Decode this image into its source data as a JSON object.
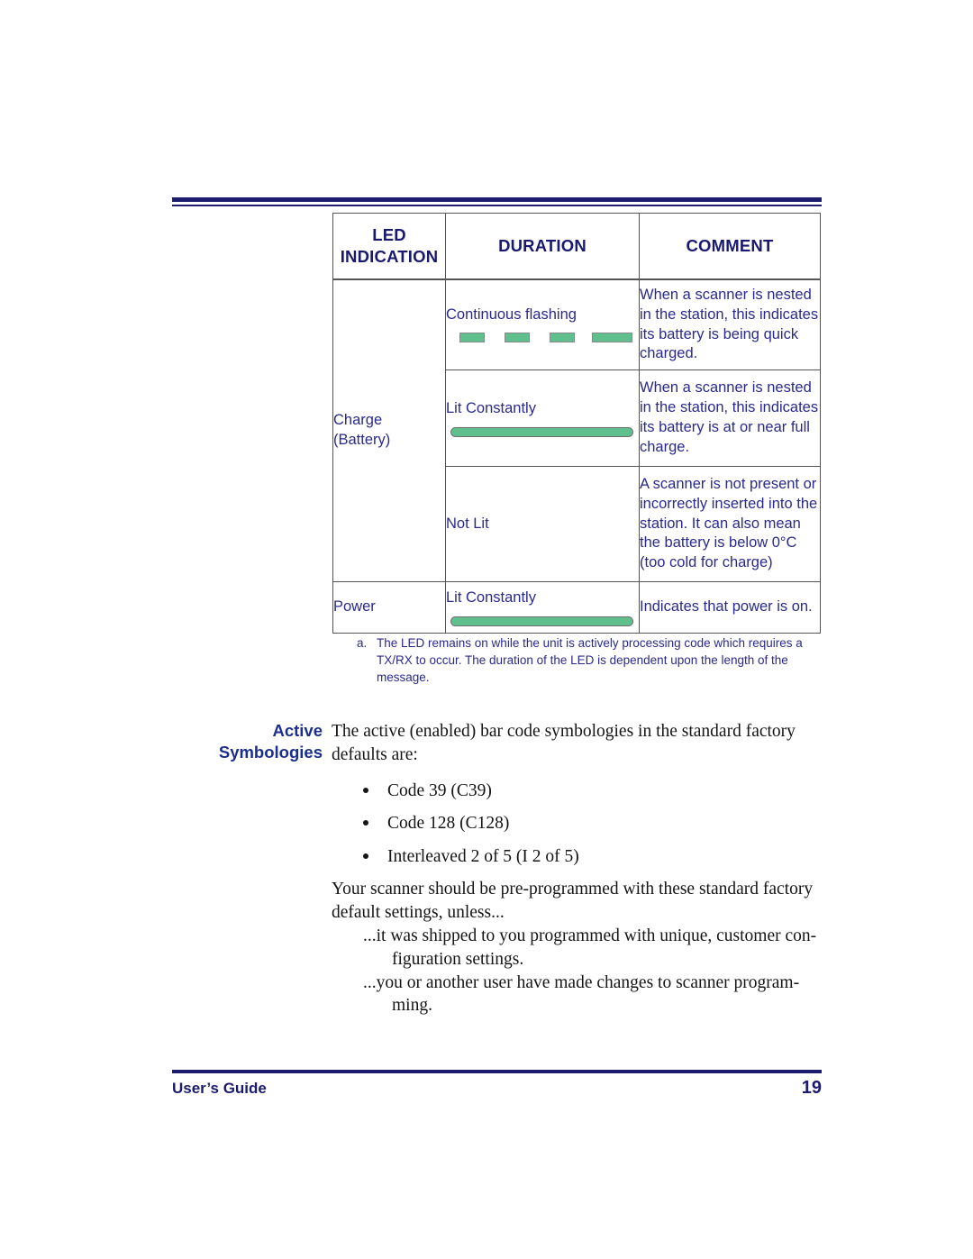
{
  "document": {
    "top_rule": true
  },
  "table": {
    "headers": [
      "LED\nINDICATION",
      "DURATION",
      "COMMENT"
    ],
    "header_led": "LED",
    "header_indication": "INDICATION",
    "header_duration": "DURATION",
    "header_comment": "COMMENT",
    "rows": [
      {
        "indication": "",
        "duration": "Continuous flashing",
        "led_graphic": "dashed-flashing-bar",
        "comment": "When a scanner is nested in the station, this indicates its battery is being quick charged."
      },
      {
        "indication": "Charge (Battery)",
        "indication_line1": "Charge",
        "indication_line2": "(Battery)",
        "duration": "Lit Constantly",
        "led_graphic": "solid-bar",
        "comment": "When a scanner is nested in the station, this indicates its battery is at or near full charge."
      },
      {
        "indication": "",
        "duration": "Not Lit",
        "led_graphic": "none",
        "comment": "A scanner is not present or incorrectly inserted into the station. It can also mean the battery is below 0°C (too cold for charge)"
      },
      {
        "indication": "Power",
        "duration": "Lit Constantly",
        "led_graphic": "solid-bar",
        "comment": "Indicates that power is on."
      }
    ]
  },
  "footnote": {
    "marker": "a.",
    "text": "The LED remains on while the unit is actively processing code which requires a TX/RX to occur. The duration of the LED is dependent upon the length of the message."
  },
  "section": {
    "heading_line1": "Active",
    "heading_line2": "Symbologies",
    "intro": "The active (enabled) bar code symbologies in the standard factory defaults are:",
    "bullets": [
      "Code 39 (C39)",
      "Code 128 (C128)",
      "Interleaved 2 of 5 (I 2 of 5)"
    ],
    "paragraph_2": "Your scanner should be pre-programmed with these standard factory default settings, unless...",
    "sub_paragraph_1": "...it was shipped to you programmed with unique, customer con-",
    "sub_paragraph_1_cont": "figuration settings.",
    "sub_paragraph_2": "...you or another user have made changes to scanner program-",
    "sub_paragraph_2_cont": "ming."
  },
  "footer": {
    "label": "User’s Guide",
    "page_number": "19"
  },
  "colors": {
    "navy": "#1b1b6f",
    "table_text": "#2a2a8c",
    "heading_blue": "#1b2f8f",
    "led_green": "#5fc08d",
    "border_gray": "#555555"
  }
}
